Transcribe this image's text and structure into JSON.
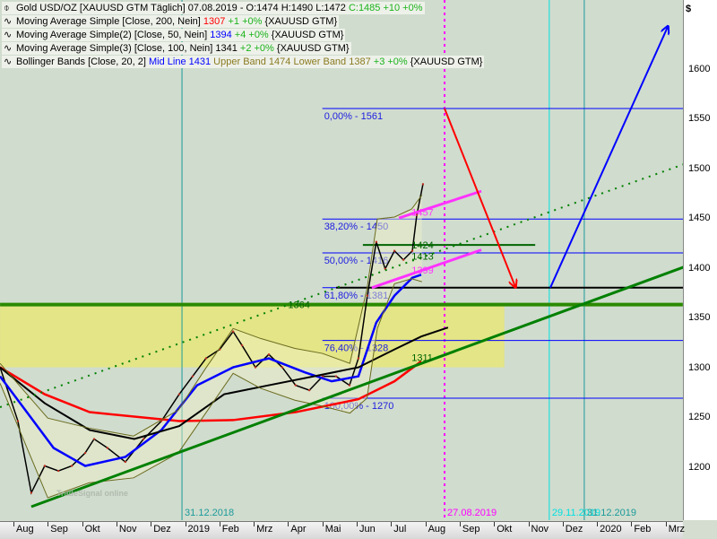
{
  "legend": [
    {
      "icon": "bar-chart-icon",
      "name": "Gold USD/OZ [XAUUSD GTM  Täglich] 07.08.2019 - O:1474 H:1490 L:1472",
      "value": "C:1485 +10 +0%",
      "value_color": "#1bb31b"
    },
    {
      "icon": "indicator-wave-icon",
      "name": "Moving Average Simple [Close, 200, Nein]",
      "value": "1307",
      "value_color": "#ff0000",
      "change": "+1 +0%",
      "suffix": "{XAUUSD GTM}"
    },
    {
      "icon": "indicator-wave-icon",
      "name": "Moving Average Simple(2) [Close, 50, Nein]",
      "value": "1394",
      "value_color": "#0000ff",
      "change": "+4 +0%",
      "suffix": "{XAUUSD GTM}"
    },
    {
      "icon": "indicator-wave-icon",
      "name": "Moving Average Simple(3) [Close, 100, Nein]",
      "value": "1341",
      "value_color": "#000000",
      "change": "+2 +0%",
      "suffix": "{XAUUSD GTM}"
    },
    {
      "icon": "indicator-wave-icon",
      "name": "Bollinger Bands [Close, 20, 2]",
      "mid_label": "Mid Line",
      "value": "1431",
      "upper": "Upper Band 1474 Lower Band 1387",
      "change": "+3 +0%",
      "suffix": "{XAUUSD GTM}"
    }
  ],
  "watermark": "TradeSignal online",
  "colors": {
    "price": "#000000",
    "ma200": "#ff0000",
    "ma50": "#0000ff",
    "ma100": "#000000",
    "bollinger": "#6b6b1e",
    "fib": "#0000ff",
    "trend": "#008000",
    "channel": "#ff33ff",
    "zone": "#e6e67a",
    "arrow_down": "#ff0000",
    "arrow_up": "#0000ff"
  },
  "chart_data": {
    "type": "line",
    "title": "Gold USD/OZ [XAUUSD GTM Täglich]",
    "ylabel": "$",
    "ylim": [
      1140,
      1660
    ],
    "y_ticks": [
      1200,
      1250,
      1300,
      1350,
      1400,
      1450,
      1500,
      1550,
      1600
    ],
    "x_unit": "months since Aug 2018",
    "xlim": [
      -0.39,
      19.5
    ],
    "x_tick_labels": [
      "Aug",
      "Sep",
      "Okt",
      "Nov",
      "Dez",
      "2019",
      "Feb",
      "Mrz",
      "Apr",
      "Mai",
      "Jun",
      "Jul",
      "Aug",
      "Sep",
      "Okt",
      "Nov",
      "Dez",
      "2020",
      "Feb",
      "Mrz"
    ],
    "series": [
      {
        "name": "Gold close",
        "key": "price",
        "x": [
          -0.39,
          0.13,
          0.52,
          0.91,
          1.31,
          1.7,
          2.09,
          2.35,
          2.74,
          3.26,
          3.79,
          4.31,
          4.83,
          5.22,
          5.61,
          6.01,
          6.4,
          6.66,
          7.05,
          7.44,
          7.83,
          8.22,
          8.62,
          9.01,
          9.4,
          9.79,
          10.05,
          10.31,
          10.57,
          10.83,
          11.1,
          11.36,
          11.62,
          11.75,
          11.93
        ],
        "y": [
          1301,
          1247,
          1175,
          1202,
          1197,
          1202,
          1215,
          1229,
          1220,
          1206,
          1229,
          1247,
          1274,
          1292,
          1310,
          1319,
          1337,
          1323,
          1301,
          1314,
          1301,
          1283,
          1278,
          1292,
          1292,
          1283,
          1310,
          1373,
          1427,
          1400,
          1418,
          1409,
          1418,
          1454,
          1485
        ]
      },
      {
        "name": "MA 200",
        "key": "ma200",
        "x": [
          -0.39,
          0.91,
          2.22,
          4.83,
          6.4,
          8.22,
          10.05,
          11.1,
          11.88
        ],
        "y": [
          1301,
          1274,
          1256,
          1247,
          1248,
          1256,
          1269,
          1287,
          1307
        ]
      },
      {
        "name": "MA 50",
        "key": "ma50",
        "x": [
          -0.39,
          0.39,
          1.17,
          2.09,
          3.26,
          4.31,
          5.35,
          6.4,
          7.44,
          8.49,
          9.27,
          10.05,
          10.57,
          11.1,
          11.62,
          11.88
        ],
        "y": [
          1292,
          1256,
          1220,
          1202,
          1211,
          1238,
          1283,
          1301,
          1310,
          1296,
          1287,
          1292,
          1346,
          1373,
          1391,
          1394
        ]
      },
      {
        "name": "MA 100",
        "key": "ma100",
        "x": [
          -0.39,
          0.91,
          2.22,
          3.52,
          4.83,
          6.14,
          7.44,
          8.75,
          10.05,
          11.1,
          11.88,
          12.66
        ],
        "y": [
          1301,
          1265,
          1238,
          1229,
          1242,
          1274,
          1283,
          1292,
          1301,
          1319,
          1332,
          1341
        ]
      },
      {
        "name": "Bollinger upper",
        "key": "bbu",
        "x": [
          -0.39,
          1.0,
          2.2,
          3.5,
          4.8,
          5.6,
          6.4,
          7.2,
          8.2,
          9.0,
          9.8,
          10.3,
          10.6,
          11.1,
          11.6,
          11.9
        ],
        "y": [
          1305,
          1250,
          1240,
          1232,
          1258,
          1300,
          1340,
          1330,
          1320,
          1315,
          1305,
          1380,
          1450,
          1452,
          1460,
          1474
        ]
      },
      {
        "name": "Bollinger lower",
        "key": "bbl",
        "x": [
          -0.39,
          1.0,
          2.2,
          3.5,
          4.8,
          5.6,
          6.4,
          7.2,
          8.2,
          9.0,
          9.8,
          10.3,
          10.6,
          11.1,
          11.6,
          11.9
        ],
        "y": [
          1285,
          1170,
          1185,
          1190,
          1215,
          1255,
          1295,
          1280,
          1268,
          1262,
          1255,
          1270,
          1340,
          1385,
          1390,
          1387
        ]
      }
    ],
    "fibonacci": [
      {
        "label": "0,00% - 1561",
        "price": 1561
      },
      {
        "label": "38,20% - 1450",
        "price": 1450
      },
      {
        "label": "50,00% - 1416",
        "price": 1416
      },
      {
        "label": "61,80% - 1381",
        "price": 1381
      },
      {
        "label": "76,40% - 1328",
        "price": 1328
      },
      {
        "label": "100,00% - 1270",
        "price": 1270
      }
    ],
    "fib_x_start": 9.0,
    "price_labels": [
      {
        "text": "1457",
        "x": 11.6,
        "y": 1457,
        "color": "#ff33ff"
      },
      {
        "text": "1424",
        "x": 11.6,
        "y": 1424,
        "color": "#006400"
      },
      {
        "text": "1413",
        "x": 11.6,
        "y": 1413,
        "color": "#006400"
      },
      {
        "text": "1399",
        "x": 11.6,
        "y": 1399,
        "color": "#ff33ff"
      },
      {
        "text": "1311",
        "x": 11.6,
        "y": 1311,
        "color": "#006400"
      },
      {
        "text": "1364",
        "x": 8.0,
        "y": 1364,
        "color": "#006400"
      }
    ],
    "zone": {
      "x": [
        -0.39,
        14.3
      ],
      "y": [
        1301,
        1364
      ]
    },
    "hlines": [
      {
        "key": "support_1364",
        "price": 1364,
        "x": [
          -0.39,
          19.5
        ],
        "color": "#2a8a00",
        "width": 4
      },
      {
        "key": "black_1381",
        "price": 1381,
        "x": [
          9.4,
          20.1
        ],
        "color": "#000000",
        "width": 2
      },
      {
        "key": "green_1424",
        "price": 1424,
        "x": [
          10.18,
          15.2
        ],
        "color": "#006400",
        "width": 2
      }
    ],
    "trendlines": [
      {
        "key": "uptrend",
        "x": [
          0.52,
          20.1
        ],
        "y": [
          1161,
          1409
        ],
        "color": "#008000",
        "width": 3,
        "dash": ""
      },
      {
        "key": "dotted-trend",
        "x": [
          -0.39,
          20.1
        ],
        "y": [
          1261,
          1512
        ],
        "color": "#008000",
        "width": 2,
        "dash": "2,6"
      },
      {
        "key": "channel-upper",
        "x": [
          11.23,
          13.63
        ],
        "y": [
          1451,
          1478
        ],
        "color": "#ff33ff",
        "width": 3,
        "dash": ""
      },
      {
        "key": "channel-lower",
        "x": [
          10.44,
          13.63
        ],
        "y": [
          1381,
          1419
        ],
        "color": "#ff33ff",
        "width": 3,
        "dash": ""
      }
    ],
    "arrows": [
      {
        "key": "arrow-down",
        "x": [
          12.56,
          14.62
        ],
        "y": [
          1561,
          1382
        ],
        "color": "#ff0000"
      },
      {
        "key": "arrow-up",
        "x": [
          15.64,
          19.06
        ],
        "y": [
          1381,
          1643
        ],
        "color": "#0000ff"
      }
    ],
    "vlines": [
      {
        "label": "31.12.2018",
        "x": 4.91,
        "color": "#1a9a9a",
        "dash": ""
      },
      {
        "label": "27.08.2019",
        "x": 12.56,
        "color": "#ff00ff",
        "dash": "3,4"
      },
      {
        "label": "29.11.2019",
        "x": 15.61,
        "color": "#00e0e0",
        "dash": ""
      },
      {
        "label": "31.12.2019",
        "x": 16.63,
        "color": "#1a9a9a",
        "dash": ""
      }
    ]
  }
}
